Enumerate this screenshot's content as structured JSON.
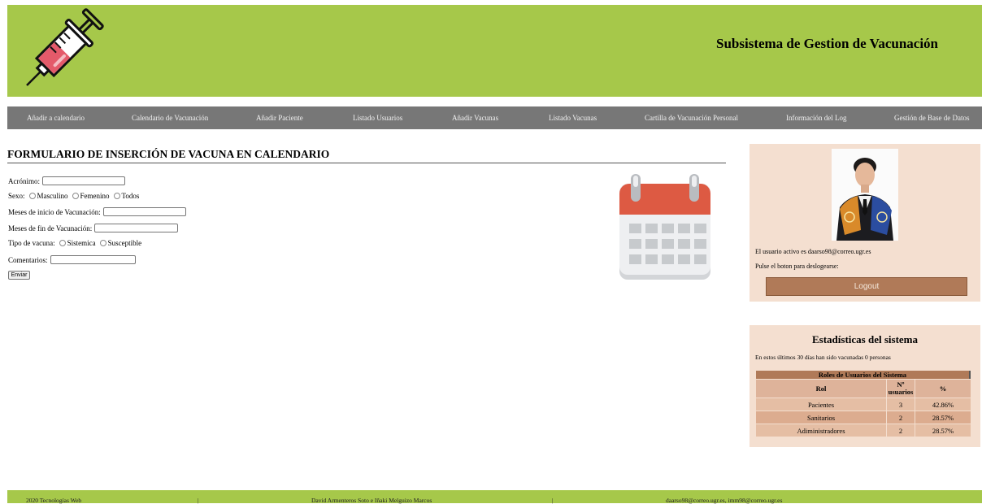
{
  "header": {
    "title": "Subsistema de Gestion de Vacunación",
    "logo_icon": "syringe-icon"
  },
  "nav": {
    "items": [
      "Añadir a calendario",
      "Calendario de Vacunación",
      "Añadir Paciente",
      "Listado Usuarios",
      "Añadir Vacunas",
      "Listado Vacunas",
      "Cartilla de Vacunación Personal",
      "Información del Log",
      "Gestión de Base de Datos"
    ]
  },
  "form": {
    "title": "FORMULARIO DE INSERCIÓN DE VACUNA EN CALENDARIO",
    "acronimo_label": "Acrónimo:",
    "acronimo_value": "",
    "sexo_label": "Sexo:",
    "sexo_options": [
      "Masculino",
      "Femenino",
      "Todos"
    ],
    "inicio_label": "Meses de inicio de Vacunación:",
    "inicio_value": "",
    "fin_label": "Meses de fin de Vacunación:",
    "fin_value": "",
    "tipo_label": "Tipo de vacuna:",
    "tipo_options": [
      "Sistemica",
      "Susceptible"
    ],
    "comentarios_label": "Comentarios:",
    "comentarios_value": "",
    "submit_label": "Enviar",
    "illustration_icon": "calendar-icon"
  },
  "user": {
    "active_text": "El usuario activo es daarso98@correo.ugr.es",
    "logout_prompt": "Pulse el boton para deslogearse:",
    "logout_label": "Logout"
  },
  "stats": {
    "title": "Estadísticas del sistema",
    "summary": "En estos últimos 30 días han sido vacunadas 0 personas",
    "table_caption": "Roles de Usuarios del Sistema",
    "headers": [
      "Rol",
      "Nº usuarios",
      "%"
    ],
    "rows": [
      {
        "rol": "Pacientes",
        "n": "3",
        "pct": "42.86%"
      },
      {
        "rol": "Sanitarios",
        "n": "2",
        "pct": "28.57%"
      },
      {
        "rol": "Adiministradores",
        "n": "2",
        "pct": "28.57%"
      }
    ]
  },
  "footer": {
    "left": "2020 Tecnologías Web",
    "sep1": "|",
    "middle": "David Armenteros Soto e Iñaki Melguizo Marcos",
    "sep2": "|",
    "right": "daarso98@correo.ugr.es, imm98@correo.ugr.es"
  },
  "colors": {
    "header_green": "#a6c84a",
    "nav_gray": "#777777",
    "panel_peach": "#f4dfd0",
    "button_brown": "#b07a58"
  }
}
